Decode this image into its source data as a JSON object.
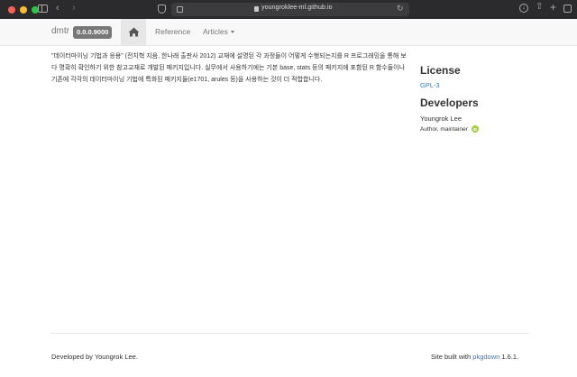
{
  "browser": {
    "url": "youngroklee-ml.github.io"
  },
  "navbar": {
    "brand": "dmtr",
    "version": "0.0.0.9000",
    "home_icon": "home-icon",
    "reference_label": "Reference",
    "articles_label": "Articles"
  },
  "main": {
    "description": "\"데이터마이닝 기법과 응용\" (전치혁 지음, 한나래 출판사 2012) 교재에 설명된 각 과정들이 어떻게 수행되는지를 R 프로그래밍을 통해 보다 명확히 확인하기 위한 참고교재로 개발된 패키지입니다. 실무에서 사용하기에는 기본 base, stats 등의 패키지에 포함된 R 함수들이나 기존에 각각의 데이터마이닝 기법에 특화된 패키지들(e1701, arules 등)을 사용하는 것이 더 적합합니다."
  },
  "sidebar": {
    "license_heading": "License",
    "license_link": "GPL-3",
    "developers_heading": "Developers",
    "developer_name": "Youngrok Lee",
    "developer_role": "Author, maintainer",
    "orcid_icon": "orcid-icon",
    "orcid_text": "iD",
    "orcid_color": "#a6ce39"
  },
  "footer": {
    "developed_by": "Developed by Youngrok Lee.",
    "built_prefix": "Site built with ",
    "pkgdown_link": "pkgdown",
    "version_suffix": " 1.6.1."
  }
}
